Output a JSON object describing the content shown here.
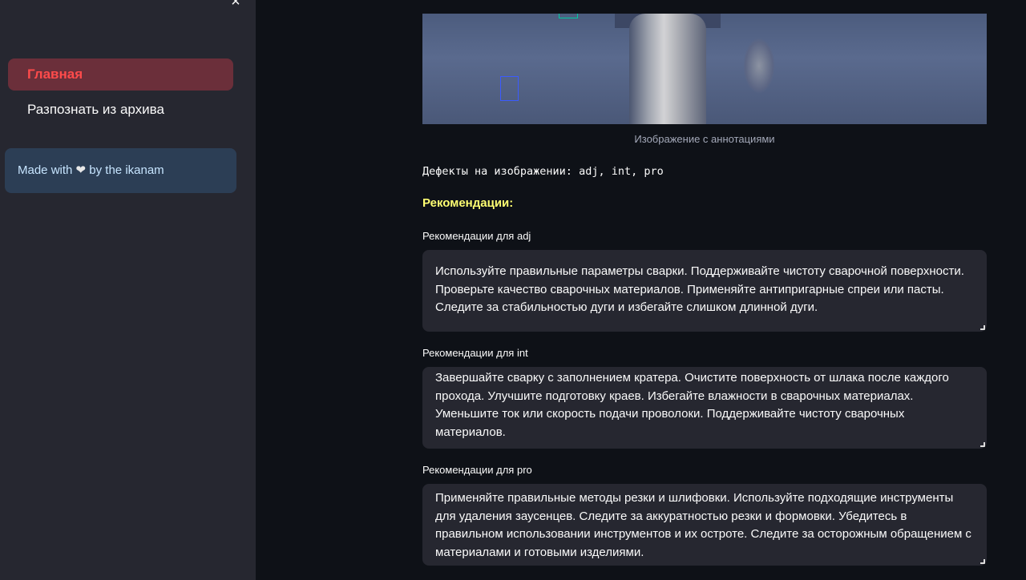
{
  "sidebar": {
    "close_icon": "×",
    "nav": [
      {
        "label": "Главная",
        "active": true
      },
      {
        "label": "Разпознать из архива",
        "active": false
      }
    ],
    "info": {
      "prefix": "Made with ",
      "heart": "❤",
      "suffix": " by the ikanam"
    }
  },
  "main": {
    "image": {
      "caption": "Изображение с аннотациями",
      "annotations": [
        {
          "label": "adj",
          "color": "#3b5bff"
        },
        {
          "label": "int",
          "color": "#00c8a0"
        }
      ]
    },
    "defects_text": "Дефекты на изображении: adj, int, pro",
    "recommendations_heading": "Рекомендации:",
    "recommendations": [
      {
        "label": "Рекомендации для adj",
        "text": "Используйте правильные параметры сварки. Поддерживайте чистоту сварочной поверхности. Проверьте качество сварочных материалов. Применяйте антипригарные спреи или пасты. Следите за стабильностью дуги и избегайте слишком длинной дуги."
      },
      {
        "label": "Рекомендации для int",
        "text": "Завершайте сварку с заполнением кратера. Очистите поверхность от шлака после каждого прохода. Улучшите подготовку краев. Избегайте влажности в сварочных материалах. Уменьшите ток или скорость подачи проволоки. Поддерживайте чистоту сварочных материалов."
      },
      {
        "label": "Рекомендации для pro",
        "text": "Применяйте правильные методы резки и шлифовки. Используйте подходящие инструменты для удаления заусенцев. Следите за аккуратностью резки и формовки. Убедитесь в правильном использовании инструментов и их остроте. Следите за осторожным обращением с материалами и готовыми изделиями."
      }
    ]
  }
}
